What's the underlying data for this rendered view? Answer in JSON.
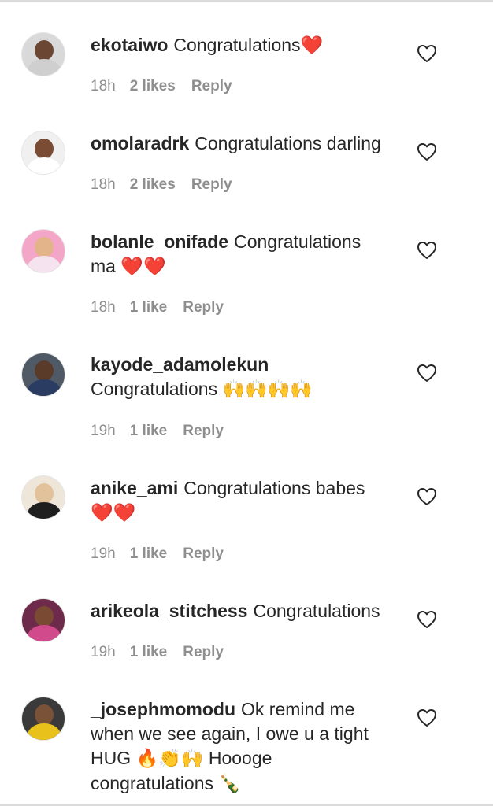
{
  "comments": [
    {
      "username": "ekotaiwo",
      "text": "Congratulations",
      "emoji": "❤️",
      "time": "18h",
      "likes": "2 likes",
      "reply": "Reply",
      "avatar": {
        "bg": "#d9d9d9",
        "skin": "#6b4632",
        "clothes": "#cfcfcf"
      }
    },
    {
      "username": "omolaradrk",
      "text": "Congratulations darling",
      "time": "18h",
      "likes": "2 likes",
      "reply": "Reply",
      "avatar": {
        "bg": "#f0f0f0",
        "skin": "#7a4c33",
        "clothes": "#ffffff"
      }
    },
    {
      "username": "bolanle_onifade",
      "text": "Congratulations ma",
      "emoji": "❤️❤️",
      "time": "18h",
      "likes": "1 like",
      "reply": "Reply",
      "avatar": {
        "bg": "#f4a6c8",
        "skin": "#e3b48a",
        "clothes": "#f5e3ef"
      }
    },
    {
      "username": "kayode_adamolekun",
      "text": "Congratulations",
      "emoji": "🙌🙌🙌🙌",
      "time": "19h",
      "likes": "1 like",
      "reply": "Reply",
      "avatar": {
        "bg": "#505a66",
        "skin": "#5a3b2a",
        "clothes": "#2b3c63"
      }
    },
    {
      "username": "anike_ami",
      "text": "Congratulations babes",
      "emoji": "❤️❤️",
      "time": "19h",
      "likes": "1 like",
      "reply": "Reply",
      "avatar": {
        "bg": "#efe6da",
        "skin": "#e2c29a",
        "clothes": "#1e1e1e"
      }
    },
    {
      "username": "arikeola_stitchess",
      "text": "Congratulations",
      "time": "19h",
      "likes": "1 like",
      "reply": "Reply",
      "avatar": {
        "bg": "#6e2a4a",
        "skin": "#7b4a33",
        "clothes": "#d04a8c"
      }
    },
    {
      "username": "_josephmomodu",
      "text": "Ok remind me when we see again, I owe u a tight HUG",
      "emoji": "🔥👏🙌",
      "text_after": "Hoooge congratulations",
      "emoji_after": "🍾",
      "avatar": {
        "bg": "#3a3a3a",
        "skin": "#7a5238",
        "clothes": "#e8c21a"
      }
    }
  ],
  "colors": {
    "text": "#262626",
    "meta": "#8e8e8e",
    "divider": "#dbdbdb",
    "heart_outline": "#262626",
    "emoji_heart": "#e8273a"
  },
  "icons": {
    "like": "heart-outline-icon"
  }
}
